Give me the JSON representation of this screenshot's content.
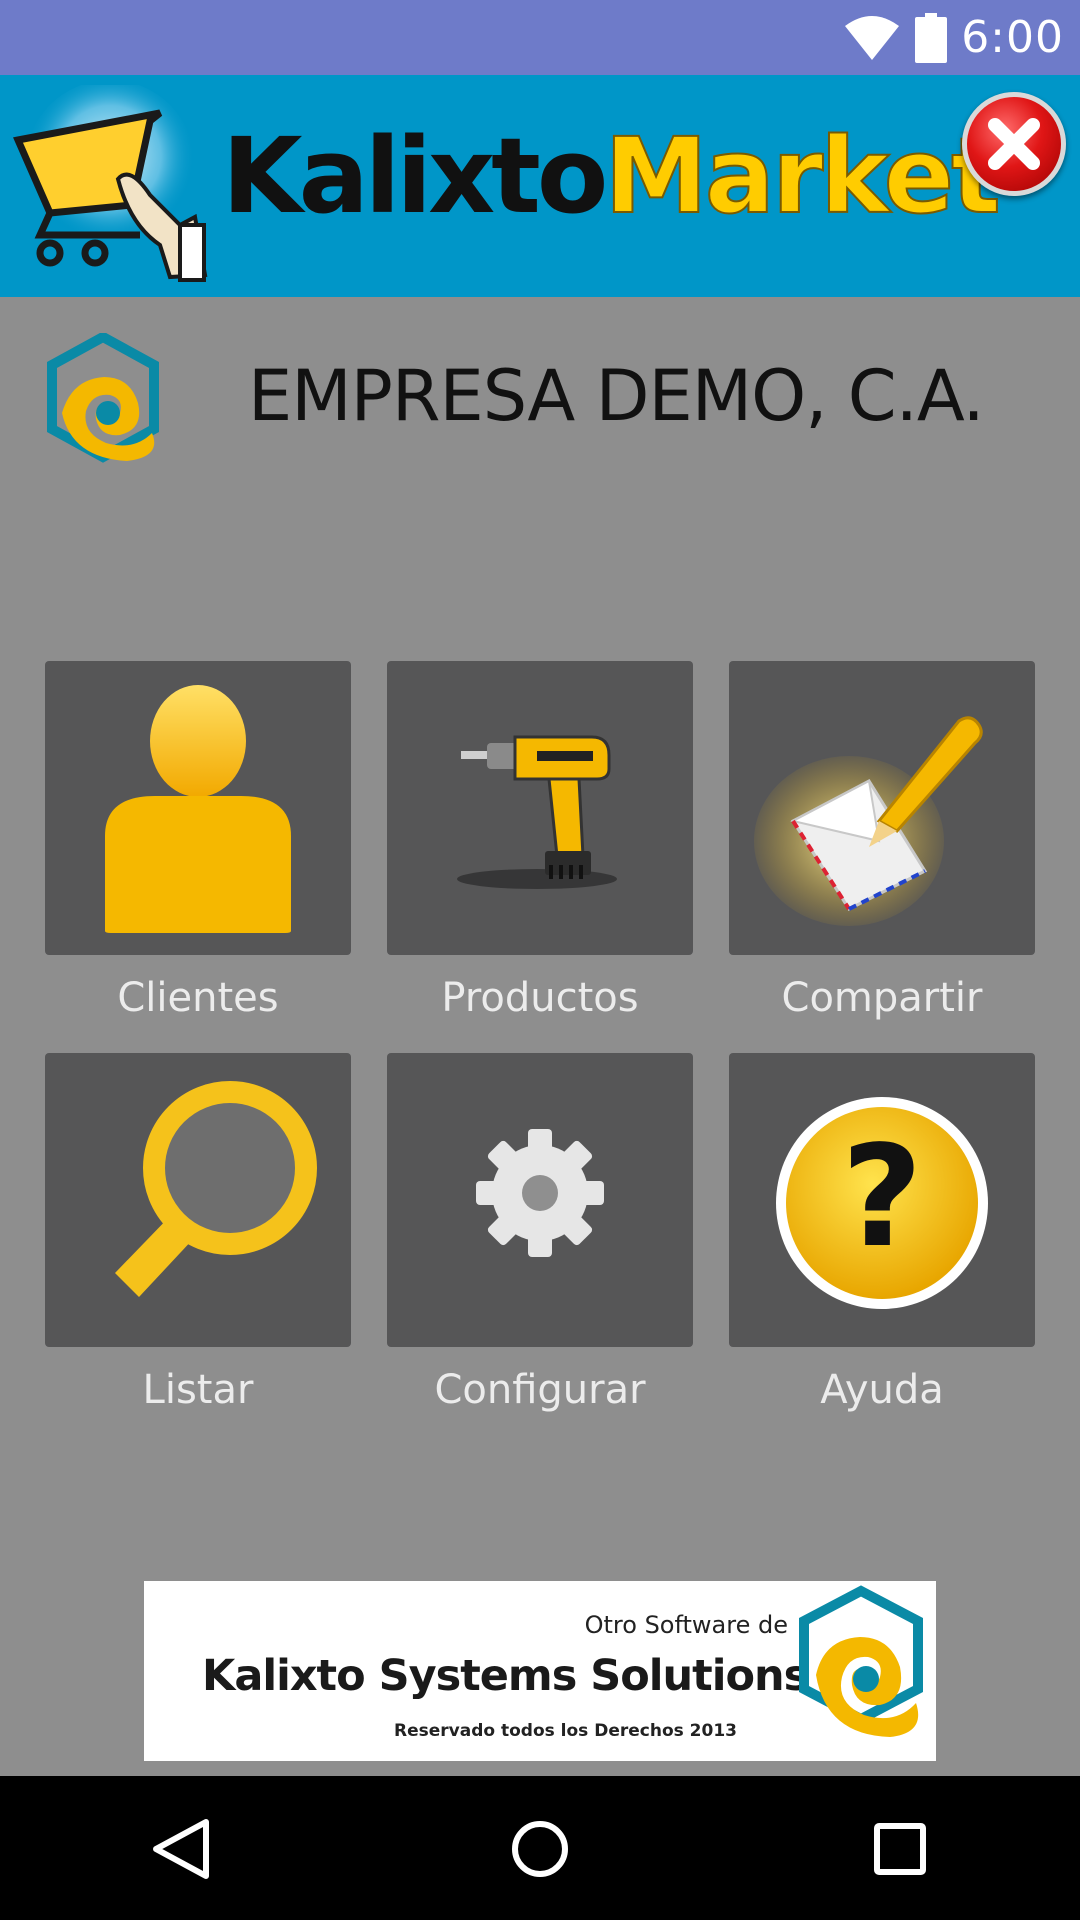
{
  "status_bar": {
    "time": "6:00",
    "icons": [
      "wifi-icon",
      "battery-icon"
    ]
  },
  "header": {
    "brand_part1": "Kalixto",
    "brand_part2": "Market",
    "close_icon": "close-icon"
  },
  "company": {
    "name": "EMPRESA DEMO, C.A."
  },
  "menu": {
    "clientes": "Clientes",
    "productos": "Productos",
    "compartir": "Compartir",
    "listar": "Listar",
    "configurar": "Configurar",
    "ayuda": "Ayuda"
  },
  "ad": {
    "small": "Otro Software de",
    "title": "Kalixto Systems Solutions",
    "rights": "Reservado todos los Derechos 2013"
  },
  "colors": {
    "status_bar": "#6e7bc9",
    "header": "#0096c8",
    "background": "#8e8e8e",
    "tile": "#565657",
    "accent_yellow": "#f5b800"
  }
}
